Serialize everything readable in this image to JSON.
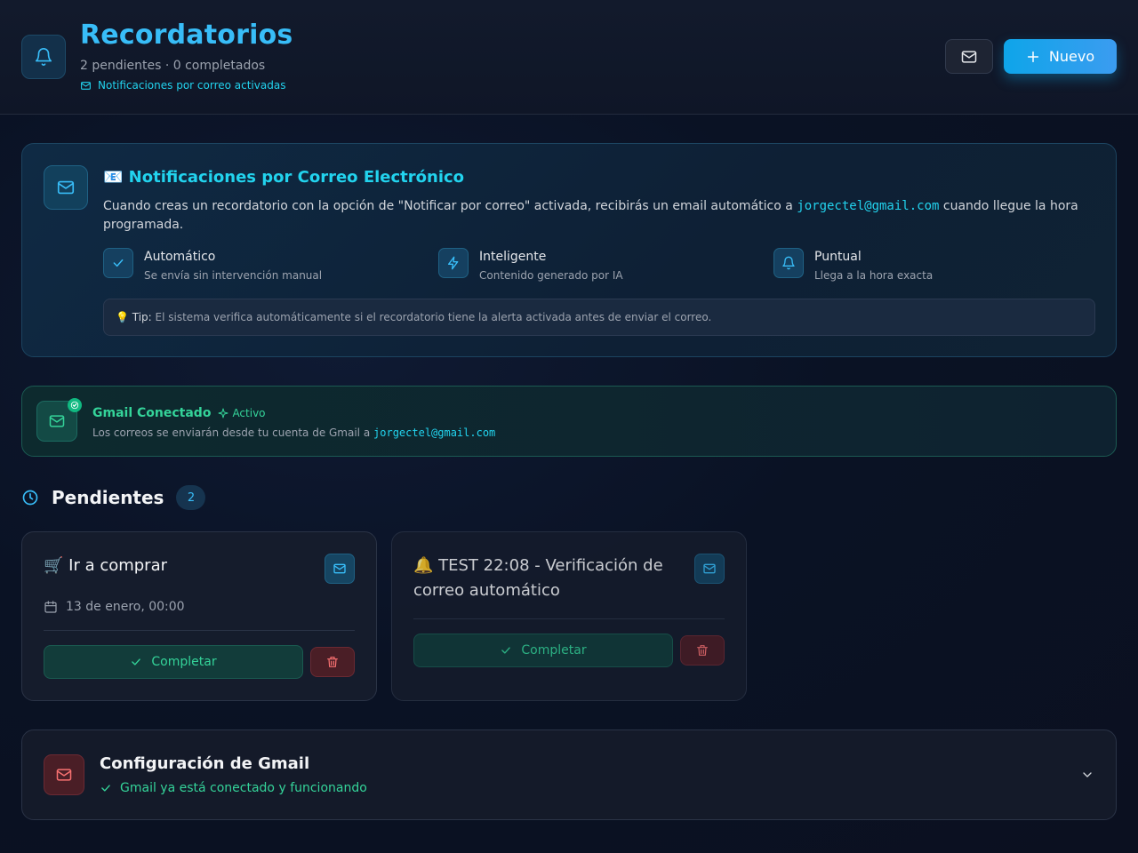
{
  "header": {
    "title": "Recordatorios",
    "subtitle": "2 pendientes · 0 completados",
    "email_status": "Notificaciones por correo activadas",
    "new_button": "Nuevo",
    "icons": [
      "bell-icon",
      "mail-icon",
      "plus-icon"
    ]
  },
  "info": {
    "title": "📧 Notificaciones por Correo Electrónico",
    "desc_before": "Cuando creas un recordatorio con la opción de \"Notificar por correo\" activada, recibirás un email automático a ",
    "email": "jorgectel@gmail.com",
    "desc_after": " cuando llegue la hora programada.",
    "features": [
      {
        "title": "Automático",
        "subtitle": "Se envía sin intervención manual",
        "icon": "check-icon"
      },
      {
        "title": "Inteligente",
        "subtitle": "Contenido generado por IA",
        "icon": "lightning-icon"
      },
      {
        "title": "Puntual",
        "subtitle": "Llega a la hora exacta",
        "icon": "bell-icon"
      }
    ],
    "tip_label": "💡 Tip:",
    "tip_text": " El sistema verifica automáticamente si el recordatorio tiene la alerta activada antes de enviar el correo."
  },
  "gmail": {
    "title": "Gmail Conectado",
    "status": "Activo",
    "desc": "Los correos se enviarán desde tu cuenta de Gmail a ",
    "email": "jorgectel@gmail.com"
  },
  "pending": {
    "title": "Pendientes",
    "count": "2",
    "items": [
      {
        "title": "🛒 Ir a comprar",
        "date": "13 de enero, 00:00",
        "complete_label": "Completar"
      },
      {
        "title": "🔔 TEST 22:08 - Verificación de correo automático",
        "date": "",
        "complete_label": "Completar"
      }
    ]
  },
  "config": {
    "title": "Configuración de Gmail",
    "subtitle": "Gmail ya está conectado y funcionando"
  },
  "colors": {
    "accent": "#38bdf8",
    "success": "#34d399",
    "danger": "#f87171",
    "background": "#0b1020"
  }
}
